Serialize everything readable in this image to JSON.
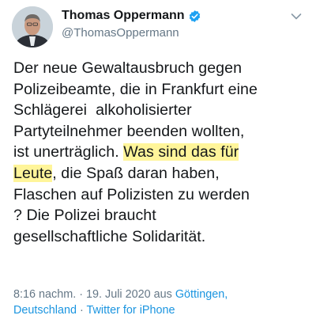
{
  "user": {
    "display_name": "Thomas Oppermann",
    "handle": "@ThomasOppermann",
    "verified": true
  },
  "icons": {
    "verified": "verified-badge-icon",
    "menu": "chevron-down-icon"
  },
  "tweet": {
    "lines": [
      {
        "pre": "Der neue Gewaltausbruch gegen",
        "hl": "",
        "post": ""
      },
      {
        "pre": "Polizeibeamte, die in Frankfurt eine",
        "hl": "",
        "post": ""
      },
      {
        "pre": "Schlägerei  alkoholisierter",
        "hl": "",
        "post": ""
      },
      {
        "pre": "Partyteilnehmer beenden wollten,",
        "hl": "",
        "post": ""
      },
      {
        "pre": "ist unerträglich. ",
        "hl": "Was sind das für",
        "post": ""
      },
      {
        "pre": "",
        "hl": "Leute",
        "post": ", die Spaß daran haben,"
      },
      {
        "pre": "Flaschen auf Polizisten zu werden",
        "hl": "",
        "post": ""
      },
      {
        "pre": "? Die Polizei braucht",
        "hl": "",
        "post": ""
      },
      {
        "pre": "gesellschaftliche Solidarität.",
        "hl": "",
        "post": ""
      }
    ]
  },
  "meta": {
    "time": "8:16 nachm.",
    "sep1": " · ",
    "date": "19. Juli 2020",
    "location_prefix": " aus ",
    "location_line1": "Göttingen,",
    "location_line2": "Deutschland",
    "sep2": " · ",
    "source": "Twitter for iPhone"
  },
  "colors": {
    "text": "#14171a",
    "muted": "#657786",
    "link": "#1b95e0",
    "highlight": "#fff59a",
    "verified": "#1da1f2"
  }
}
